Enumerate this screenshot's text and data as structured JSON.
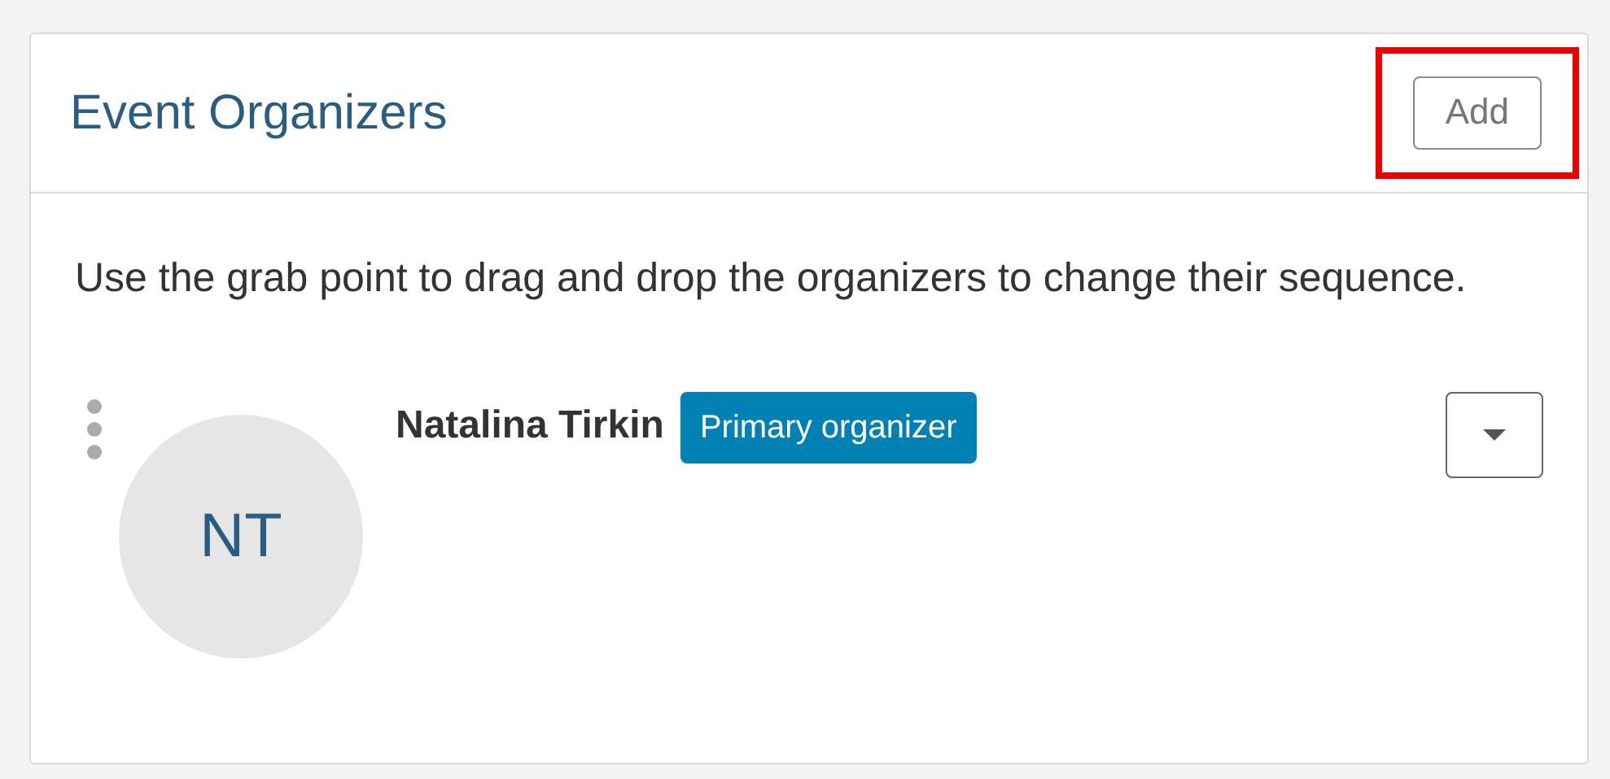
{
  "panel": {
    "title": "Event Organizers",
    "add_button": {
      "label": "Add",
      "highlighted": true
    }
  },
  "instructions": "Use the grab point to drag and drop the organizers to change their sequence.",
  "organizers": [
    {
      "initials": "NT",
      "name": "Natalina Tirkin",
      "badge": "Primary organizer"
    }
  ]
}
